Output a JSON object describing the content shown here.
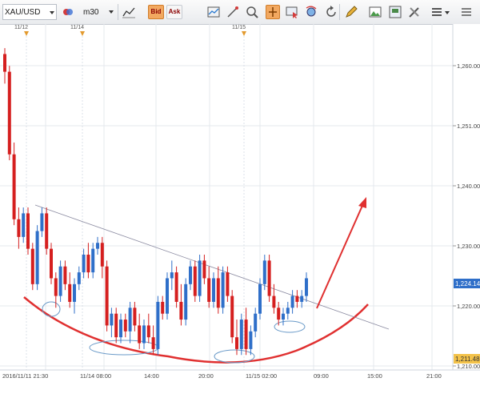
{
  "toolbar": {
    "symbol": "XAU/USD",
    "timeframe": "m30",
    "bid_label": "Bid",
    "ask_label": "Ask"
  },
  "date_flags": [
    "11/12",
    "11/14",
    "11/15"
  ],
  "price_axis": {
    "labels": [
      "1,260.00",
      "1,251.00",
      "1,240.00",
      "1,230.00",
      "1,220.00",
      "1,210.00"
    ],
    "current_price": "1,224.14",
    "low_marker": "1,211.48"
  },
  "time_axis": {
    "labels": [
      "2016/11/11 21:30",
      "11/14 08:00",
      "14:00",
      "20:00",
      "11/15 02:00",
      "09:00",
      "15:00",
      "21:00"
    ]
  },
  "colors": {
    "bull": "#2f6fc9",
    "bear": "#d51f1f",
    "annotation": "#e03030",
    "trendline": "#8a8aa0",
    "ellipse": "#6a9ac8",
    "current_price_bg": "#2f6fc9"
  },
  "chart_data": {
    "type": "candlestick",
    "ylim": [
      1209,
      1266
    ],
    "candles": [
      [
        1262,
        1263,
        1257,
        1259
      ],
      [
        1259,
        1260,
        1244,
        1245
      ],
      [
        1245,
        1247,
        1233,
        1234
      ],
      [
        1234,
        1236,
        1229,
        1231
      ],
      [
        1231,
        1236,
        1230,
        1235
      ],
      [
        1235,
        1236,
        1228,
        1229
      ],
      [
        1229,
        1230,
        1222,
        1223
      ],
      [
        1223,
        1233,
        1222,
        1232
      ],
      [
        1232,
        1236,
        1231,
        1235
      ],
      [
        1235,
        1236,
        1228,
        1229
      ],
      [
        1229,
        1230,
        1223,
        1224
      ],
      [
        1224,
        1225,
        1219,
        1221
      ],
      [
        1221,
        1227,
        1220,
        1226
      ],
      [
        1226,
        1227,
        1222,
        1223
      ],
      [
        1223,
        1225,
        1219,
        1220
      ],
      [
        1220,
        1224,
        1218,
        1223
      ],
      [
        1223,
        1226,
        1222,
        1225
      ],
      [
        1225,
        1229,
        1224,
        1228
      ],
      [
        1228,
        1230,
        1224,
        1225
      ],
      [
        1225,
        1230,
        1224,
        1229
      ],
      [
        1229,
        1231,
        1228,
        1230
      ],
      [
        1230,
        1231,
        1224,
        1226
      ],
      [
        1226,
        1227,
        1215,
        1216
      ],
      [
        1216,
        1219,
        1214,
        1218
      ],
      [
        1218,
        1219,
        1213,
        1214
      ],
      [
        1214,
        1218,
        1213,
        1217
      ],
      [
        1217,
        1218,
        1214,
        1215
      ],
      [
        1215,
        1220,
        1213,
        1219
      ],
      [
        1219,
        1220,
        1215,
        1216
      ],
      [
        1216,
        1218,
        1212,
        1213
      ],
      [
        1213,
        1217,
        1212,
        1216
      ],
      [
        1216,
        1218,
        1213,
        1214
      ],
      [
        1214,
        1216,
        1211,
        1212
      ],
      [
        1212,
        1221,
        1211,
        1220
      ],
      [
        1220,
        1221,
        1217,
        1218
      ],
      [
        1218,
        1225,
        1217,
        1224
      ],
      [
        1224,
        1227,
        1222,
        1225
      ],
      [
        1225,
        1226,
        1219,
        1220
      ],
      [
        1220,
        1223,
        1216,
        1217
      ],
      [
        1217,
        1224,
        1216,
        1223
      ],
      [
        1223,
        1227,
        1222,
        1226
      ],
      [
        1226,
        1227,
        1220,
        1221
      ],
      [
        1221,
        1228,
        1220,
        1227
      ],
      [
        1227,
        1228,
        1223,
        1224
      ],
      [
        1224,
        1226,
        1219,
        1220
      ],
      [
        1220,
        1225,
        1219,
        1224
      ],
      [
        1224,
        1226,
        1218,
        1219
      ],
      [
        1219,
        1226,
        1218,
        1225
      ],
      [
        1225,
        1226,
        1220,
        1221
      ],
      [
        1221,
        1222,
        1213,
        1214
      ],
      [
        1214,
        1217,
        1211,
        1212
      ],
      [
        1212,
        1218,
        1211,
        1217
      ],
      [
        1217,
        1219,
        1211,
        1212
      ],
      [
        1212,
        1216,
        1211,
        1215
      ],
      [
        1215,
        1219,
        1214,
        1218
      ],
      [
        1218,
        1224,
        1217,
        1223
      ],
      [
        1223,
        1228,
        1222,
        1227
      ],
      [
        1227,
        1228,
        1220,
        1221
      ],
      [
        1221,
        1223,
        1218,
        1219
      ],
      [
        1219,
        1220,
        1216,
        1217
      ],
      [
        1217,
        1219,
        1216,
        1218
      ],
      [
        1218,
        1220,
        1217,
        1219
      ],
      [
        1219,
        1222,
        1218,
        1221
      ],
      [
        1221,
        1222,
        1219,
        1220
      ],
      [
        1220,
        1222,
        1219,
        1221
      ],
      [
        1221,
        1225,
        1220,
        1224
      ]
    ]
  }
}
